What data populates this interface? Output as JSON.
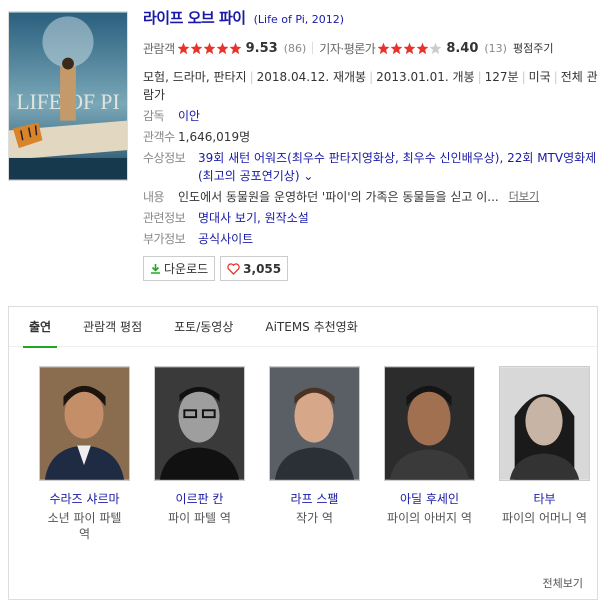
{
  "movie": {
    "title": "라이프 오브 파이",
    "original_title": "(Life of Pi, 2012)",
    "poster_title": "LIFE OF PI",
    "audience": {
      "label": "관람객",
      "stars": 5,
      "score": "9.53",
      "count": "(86)"
    },
    "critics": {
      "label": "기자·평론가",
      "stars": 4,
      "score": "8.40",
      "count": "(13)"
    },
    "rate_link": "평점주기",
    "genres": "모험, 드라마, 판타지",
    "rerelease": "2018.04.12. 재개봉",
    "release": "2013.01.01. 개봉",
    "runtime": "127분",
    "country": "미국",
    "age": "전체 관람가",
    "director_label": "감독",
    "director": "이안",
    "viewers_label": "관객수",
    "viewers": "1,646,019명",
    "awards_label": "수상정보",
    "awards": "39회 새턴 어워즈(최우수 판타지영화상, 최우수 신인배우상), 22회 MTV영화제(최고의 공포연기상)",
    "plot_label": "내용",
    "plot": "인도에서 동물원을 운영하던 '파이'의 가족은 동물들을 싣고 이...",
    "plot_more": "더보기",
    "related_label": "관련정보",
    "related": "명대사 보기, 원작소설",
    "extra_label": "부가정보",
    "extra": "공식사이트",
    "download_label": "다운로드",
    "like_count": "3,055"
  },
  "colors": {
    "link": "#1a1aa6",
    "star": "#e8322c",
    "accent": "#21a821"
  },
  "tabs": [
    {
      "label": "출연",
      "active": true
    },
    {
      "label": "관람객 평점",
      "active": false
    },
    {
      "label": "포토/동영상",
      "active": false
    },
    {
      "label": "AiTEMS 추천영화",
      "active": false
    }
  ],
  "cast": [
    {
      "name": "수라즈 샤르마",
      "role": "소년 파이 파텔 역"
    },
    {
      "name": "이르판 칸",
      "role": "파이 파텔 역"
    },
    {
      "name": "라프 스팰",
      "role": "작가 역"
    },
    {
      "name": "아딜 후세인",
      "role": "파이의 아버지 역"
    },
    {
      "name": "타부",
      "role": "파이의 어머니 역"
    }
  ],
  "see_all": "전체보기"
}
